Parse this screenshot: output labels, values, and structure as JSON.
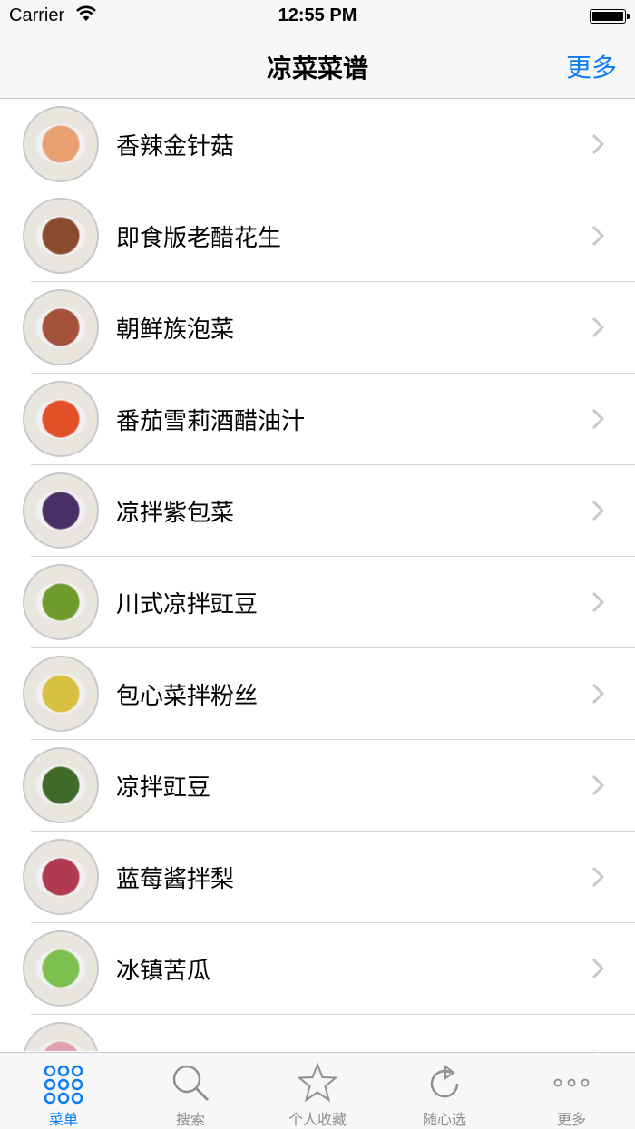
{
  "status_bar": {
    "carrier": "Carrier",
    "time": "12:55 PM"
  },
  "nav": {
    "title": "凉菜菜谱",
    "more": "更多"
  },
  "recipes": [
    {
      "name": "香辣金针菇",
      "thumb_color": "#e8a070"
    },
    {
      "name": "即食版老醋花生",
      "thumb_color": "#8a4a30"
    },
    {
      "name": "朝鲜族泡菜",
      "thumb_color": "#a4523a"
    },
    {
      "name": "番茄雪莉酒醋油汁",
      "thumb_color": "#e2502a"
    },
    {
      "name": "凉拌紫包菜",
      "thumb_color": "#4a2f66"
    },
    {
      "name": "川式凉拌豇豆",
      "thumb_color": "#6f9a2c"
    },
    {
      "name": "包心菜拌粉丝",
      "thumb_color": "#d8c040"
    },
    {
      "name": "凉拌豇豆",
      "thumb_color": "#3f6a2a"
    },
    {
      "name": "蓝莓酱拌梨",
      "thumb_color": "#b03a50"
    },
    {
      "name": "冰镇苦瓜",
      "thumb_color": "#7cc050"
    },
    {
      "name": "",
      "thumb_color": "#e0a0b0"
    }
  ],
  "tabs": [
    {
      "label": "菜单",
      "icon": "grid-icon",
      "active": true
    },
    {
      "label": "搜索",
      "icon": "search-icon",
      "active": false
    },
    {
      "label": "个人收藏",
      "icon": "star-icon",
      "active": false
    },
    {
      "label": "随心选",
      "icon": "refresh-icon",
      "active": false
    },
    {
      "label": "更多",
      "icon": "ellipsis-icon",
      "active": false
    }
  ],
  "colors": {
    "accent": "#0a7cf1",
    "inactive": "#8e8e93"
  }
}
